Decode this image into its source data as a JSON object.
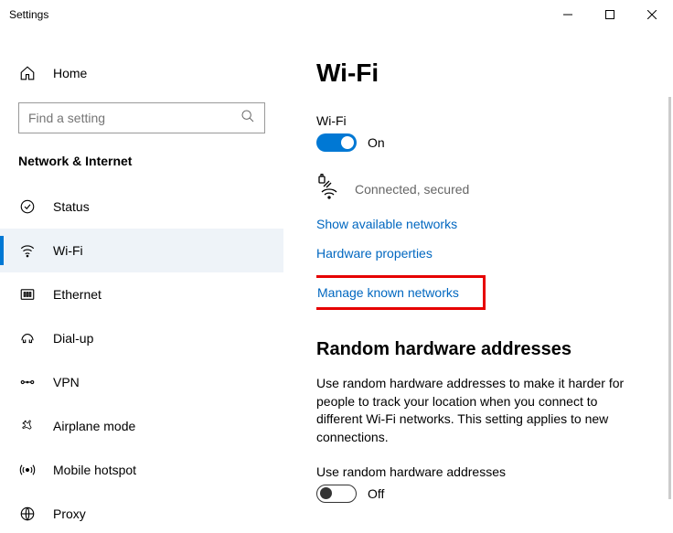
{
  "titlebar": {
    "title": "Settings"
  },
  "sidebar": {
    "home_label": "Home",
    "search_placeholder": "Find a setting",
    "section_header": "Network & Internet",
    "items": [
      {
        "label": "Status"
      },
      {
        "label": "Wi-Fi"
      },
      {
        "label": "Ethernet"
      },
      {
        "label": "Dial-up"
      },
      {
        "label": "VPN"
      },
      {
        "label": "Airplane mode"
      },
      {
        "label": "Mobile hotspot"
      },
      {
        "label": "Proxy"
      }
    ]
  },
  "content": {
    "page_title": "Wi-Fi",
    "wifi_label": "Wi-Fi",
    "wifi_toggle_state": "On",
    "connection_status": "Connected, secured",
    "link_show_available": "Show available networks",
    "link_hw_props": "Hardware properties",
    "link_manage_known": "Manage known networks",
    "random_hw_title": "Random hardware addresses",
    "random_hw_desc": "Use random hardware addresses to make it harder for people to track your location when you connect to different Wi-Fi networks. This setting applies to new connections.",
    "random_hw_label": "Use random hardware addresses",
    "random_hw_toggle_state": "Off"
  }
}
